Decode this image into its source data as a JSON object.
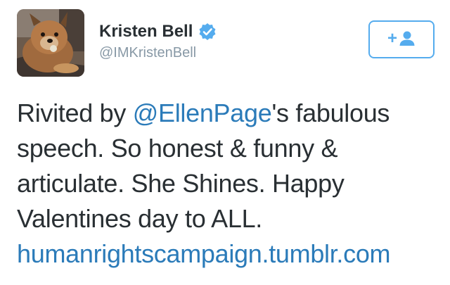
{
  "author": {
    "name": "Kristen Bell",
    "handle": "@IMKristenBell",
    "verified": true,
    "avatar_icon": "dog-profile-photo"
  },
  "follow_button": {
    "icon": "follow-user-icon",
    "plus_label": "+"
  },
  "tweet": {
    "line1_prefix": "Rivited by ",
    "mention": "@EllenPage",
    "line1_suffix": "'s fabulous",
    "line2": "speech. So honest & funny &",
    "line3": "articulate. She Shines. Happy",
    "line4": "Valentines day to ALL.",
    "link": "humanrightscampaign.tumblr.com"
  },
  "colors": {
    "link": "#2b7bb9",
    "text": "#292f33",
    "handle": "#8899a6",
    "accent": "#55acee"
  }
}
